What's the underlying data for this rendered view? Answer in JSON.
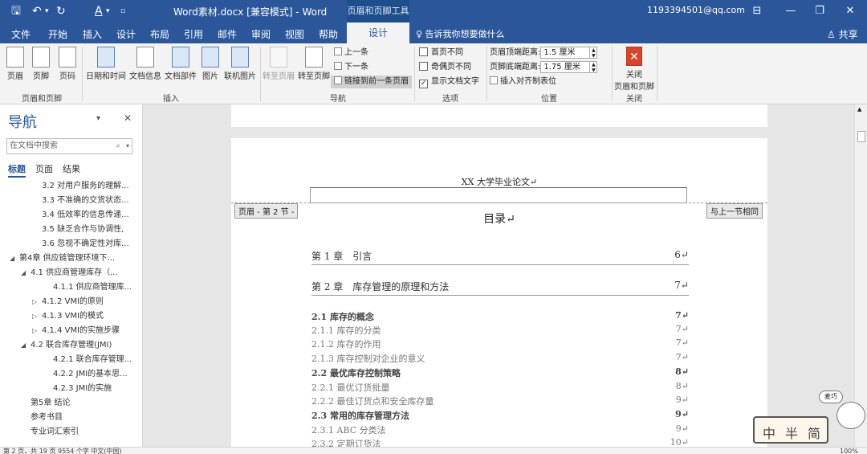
{
  "titlebar": {
    "doc_title": "Word素材.docx [兼容模式]  -  Word",
    "context_title": "页眉和页脚工具",
    "account": "1193394501@qq.com",
    "quick_access": {
      "save": "🖫",
      "undo": "↶",
      "undo_more": "▾",
      "redo": "↻",
      "format": "A",
      "format_more": "▾",
      "customize": "▫"
    },
    "window": {
      "restore_ribbon": "⊟",
      "minimize": "—",
      "maximize": "❐",
      "close": "✕"
    }
  },
  "tabs": [
    "文件",
    "开始",
    "插入",
    "设计",
    "布局",
    "引用",
    "邮件",
    "审阅",
    "视图",
    "帮助"
  ],
  "context_tab": "设计",
  "tellme": "♀ 告诉我你想要做什么",
  "share": "♙ 共享",
  "ribbon": {
    "group1": {
      "buttons": [
        "页眉",
        "页脚",
        "页码"
      ],
      "label": "页眉和页脚"
    },
    "group2": {
      "buttons": [
        "日期和时间",
        "文档信息",
        "文档部件",
        "图片",
        "联机图片"
      ],
      "label": "插入"
    },
    "group3": {
      "buttons": [
        "转至页眉",
        "转至页脚"
      ],
      "prev": "上一条",
      "next": "下一条",
      "link": "链接到前一条页眉",
      "label": "导航"
    },
    "group4": {
      "first_page": "首页不同",
      "odd_even": "奇偶页不同",
      "show_doc_text": "显示文档文字",
      "check_mark": "✓",
      "label": "选项"
    },
    "group5": {
      "header_top_label": "页眉顶端距离:",
      "header_top_value": "1.5 厘米",
      "footer_bottom_label": "页脚底端距离:",
      "footer_bottom_value": "1.75 厘米",
      "insert_tab": "插入对齐制表位",
      "label": "位置"
    },
    "group6": {
      "close_line1": "关闭",
      "close_line2": "页眉和页脚",
      "label": "关闭",
      "close_glyph": "✕"
    }
  },
  "nav": {
    "title": "导航",
    "dropdown": "▾",
    "close": "✕",
    "search_placeholder": "在文档中搜索",
    "search_icon": "⌕",
    "tabs": [
      "标题",
      "页面",
      "结果"
    ],
    "items": [
      {
        "text": "3.2 对用户服务的理解...",
        "tw": ""
      },
      {
        "text": "3.3 不准确的交货状态...",
        "tw": ""
      },
      {
        "text": "3.4 低效率的信息传递...",
        "tw": ""
      },
      {
        "text": "3.5 缺乏合作与协调性,",
        "tw": ""
      },
      {
        "text": "3.6 忽视不确定性对库...",
        "tw": ""
      },
      {
        "text": "第4章 供应链管理环境下...",
        "tw": "◢"
      },
      {
        "text": "4.1 供应商管理库存（...",
        "tw": "◢"
      },
      {
        "text": "4.1.1 供应商管理库...",
        "tw": ""
      },
      {
        "text": "4.1.2 VMI的原则",
        "tw": "▷"
      },
      {
        "text": "4.1.3 VMI的模式",
        "tw": "▷"
      },
      {
        "text": "4.1.4 VMI的实施步骤",
        "tw": "▷"
      },
      {
        "text": "4.2 联合库存管理(JMI)",
        "tw": "◢"
      },
      {
        "text": "4.2.1 联合库存管理...",
        "tw": ""
      },
      {
        "text": "4.2.2 JMI的基本思...",
        "tw": ""
      },
      {
        "text": "4.2.3 JMI的实施",
        "tw": ""
      },
      {
        "text": "第5章 结论",
        "tw": ""
      },
      {
        "text": "参考书目",
        "tw": ""
      },
      {
        "text": "专业词汇索引",
        "tw": ""
      }
    ]
  },
  "document": {
    "header_text": "XX 大学毕业论文↵",
    "header_tag_left": "页眉 - 第 2 节 -",
    "header_tag_right": "与上一节相同",
    "toc_title": "目录↵",
    "toc": [
      {
        "text": "第 1 章　引言",
        "page": "6↵",
        "level": "ch"
      },
      {
        "text": "第 2 章　库存管理的原理和方法",
        "page": "7↵",
        "level": "ch"
      },
      {
        "text": "2.1 库存的概念",
        "page": "7↵",
        "level": "l2"
      },
      {
        "text": "2.1.1 库存的分类",
        "page": "7↵",
        "level": "l3"
      },
      {
        "text": "2.1.2 库存的作用",
        "page": "7↵",
        "level": "l3"
      },
      {
        "text": "2.1.3 库存控制对企业的意义",
        "page": "7↵",
        "level": "l3"
      },
      {
        "text": "2.2 最优库存控制策略",
        "page": "8↵",
        "level": "l2"
      },
      {
        "text": "2.2.1 最优订货批量",
        "page": "8↵",
        "level": "l3"
      },
      {
        "text": "2.2.2 最佳订货点和安全库存量",
        "page": "9↵",
        "level": "l3"
      },
      {
        "text": "2.3 常用的库存管理方法",
        "page": "9↵",
        "level": "l2"
      },
      {
        "text": "2.3.1 ABC 分类法",
        "page": "9↵",
        "level": "l3"
      },
      {
        "text": "2.3.2 定期订货法",
        "page": "10↵",
        "level": "l3"
      }
    ]
  },
  "statusbar": {
    "text": "第 2 页，共 19 页    9554 个字    中文(中国)",
    "zoom": "100%"
  },
  "stamp": {
    "chars": [
      "中",
      "半",
      "简"
    ],
    "bubble": "麦巧"
  }
}
